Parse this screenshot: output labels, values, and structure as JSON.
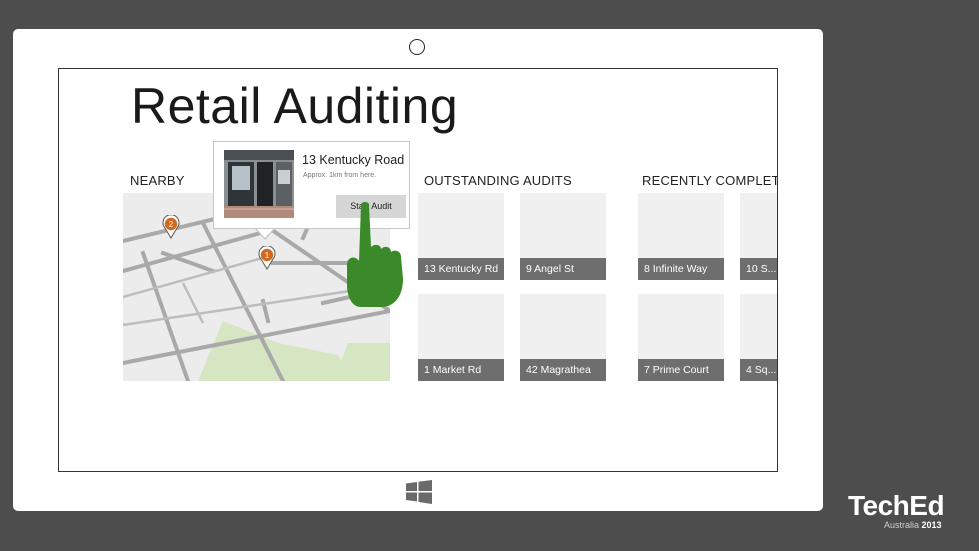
{
  "app": {
    "title": "Retail Auditing"
  },
  "sections": {
    "nearby": "NEARBY",
    "outstanding": "OUTSTANDING AUDITS",
    "recent": "RECENTLY COMPLETE"
  },
  "map": {
    "pins": [
      {
        "label": "2"
      },
      {
        "label": "1"
      }
    ]
  },
  "popup": {
    "address": "13 Kentucky Road",
    "distance": "Approx. 1km from here.",
    "action": "Start Audit"
  },
  "outstanding_audits": [
    {
      "name": "13 Kentucky Rd"
    },
    {
      "name": "9 Angel St"
    },
    {
      "name": "1 Market Rd"
    },
    {
      "name": "42 Magrathea"
    }
  ],
  "recent_audits": [
    {
      "name": "8 Infinite Way"
    },
    {
      "name": "10 S..."
    },
    {
      "name": "7 Prime Court"
    },
    {
      "name": "4 Sq..."
    }
  ],
  "branding": {
    "logo": "TechEd",
    "region": "Australia",
    "year": "2013"
  },
  "colors": {
    "pin": "#d2691e",
    "hand": "#3a8a2a",
    "tile_caption": "#6e6e6e"
  },
  "icons": [
    "map-pin-icon",
    "windows-logo-icon",
    "pointing-hand-icon",
    "camera-icon"
  ]
}
